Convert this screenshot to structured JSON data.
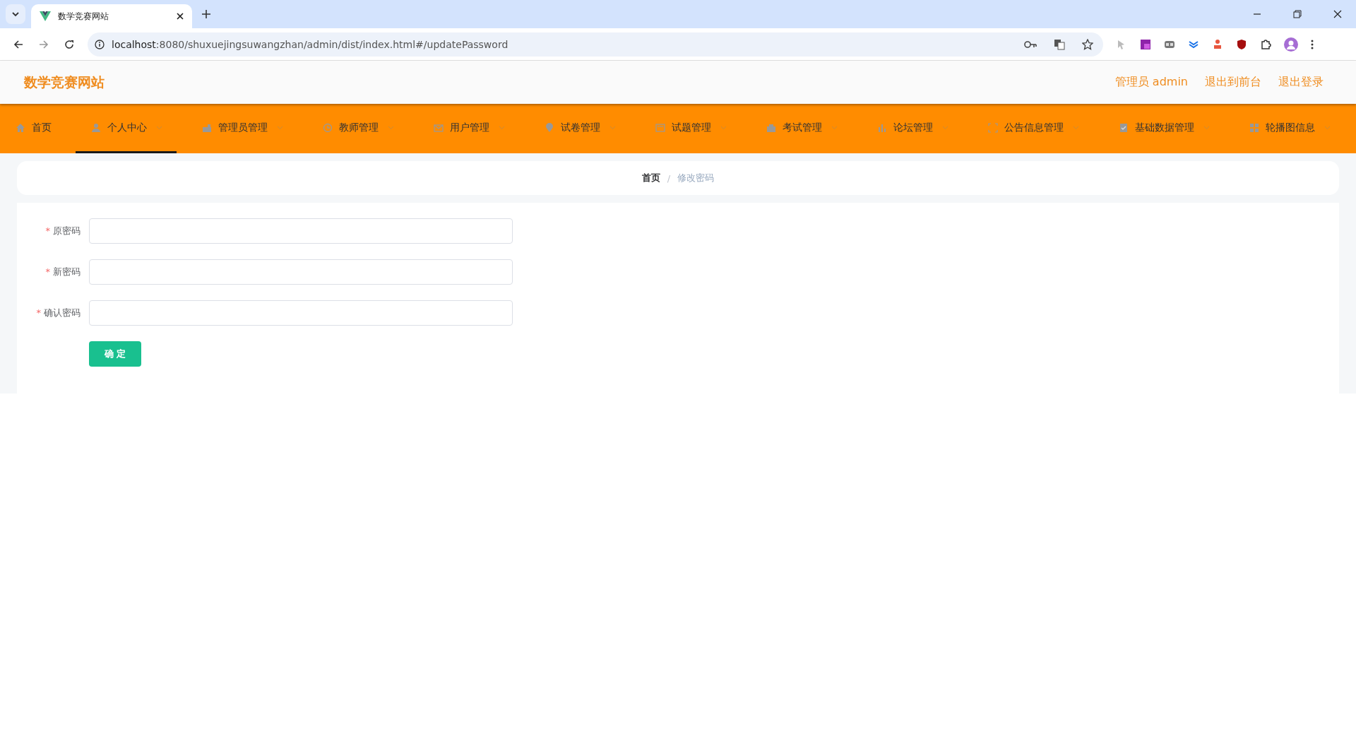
{
  "browser": {
    "tab_title": "数学竞赛网站",
    "url_host": "localhost",
    "url_rest": ":8080/shuxuejingsuwangzhan/admin/dist/index.html#/updatePassword"
  },
  "header": {
    "site_title": "数学竞赛网站",
    "links": [
      "管理员 admin",
      "退出到前台",
      "退出登录"
    ]
  },
  "nav": [
    {
      "label": "首页",
      "selected": false,
      "dropdown": false
    },
    {
      "label": "个人中心",
      "selected": true,
      "dropdown": true
    },
    {
      "label": "管理员管理",
      "selected": false,
      "dropdown": true
    },
    {
      "label": "教师管理",
      "selected": false,
      "dropdown": true
    },
    {
      "label": "用户管理",
      "selected": false,
      "dropdown": true
    },
    {
      "label": "试卷管理",
      "selected": false,
      "dropdown": true
    },
    {
      "label": "试题管理",
      "selected": false,
      "dropdown": true
    },
    {
      "label": "考试管理",
      "selected": false,
      "dropdown": true
    },
    {
      "label": "论坛管理",
      "selected": false,
      "dropdown": true
    },
    {
      "label": "公告信息管理",
      "selected": false,
      "dropdown": true
    },
    {
      "label": "基础数据管理",
      "selected": false,
      "dropdown": true
    },
    {
      "label": "轮播图信息",
      "selected": false,
      "dropdown": true
    }
  ],
  "breadcrumb": {
    "items": [
      "首页",
      "修改密码"
    ],
    "separator": "/"
  },
  "form": {
    "fields": [
      {
        "label": "原密码",
        "required_mark": "*"
      },
      {
        "label": "新密码",
        "required_mark": "*"
      },
      {
        "label": "确认密码",
        "required_mark": "*"
      }
    ],
    "submit": "确 定"
  }
}
